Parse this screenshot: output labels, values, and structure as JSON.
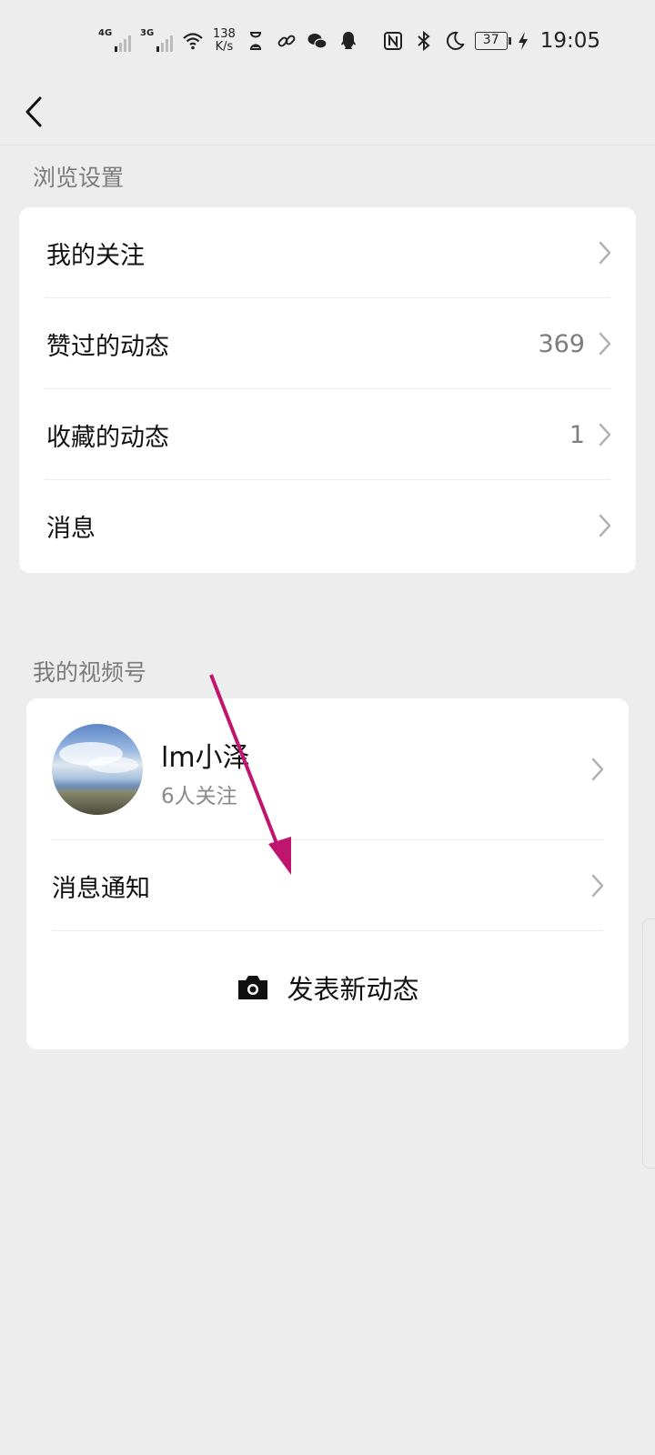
{
  "status_bar": {
    "network1": "4G",
    "network2": "3G",
    "speed_value": "138",
    "speed_unit": "K/s",
    "battery": "37",
    "time": "19:05",
    "icons": [
      "hourglass-icon",
      "link-icon",
      "wechat-icon",
      "qq-icon",
      "nfc-icon",
      "bluetooth-icon",
      "moon-icon",
      "charging-icon"
    ]
  },
  "browse": {
    "title": "浏览设置",
    "items": [
      {
        "label": "我的关注",
        "count": ""
      },
      {
        "label": "赞过的动态",
        "count": "369"
      },
      {
        "label": "收藏的动态",
        "count": "1"
      },
      {
        "label": "消息",
        "count": ""
      }
    ]
  },
  "channel": {
    "title": "我的视频号",
    "profile_name": "lm小泽",
    "profile_followers": "6人关注",
    "notification_label": "消息通知",
    "publish_label": "发表新动态"
  },
  "annotation": {
    "color": "#c0156e"
  }
}
